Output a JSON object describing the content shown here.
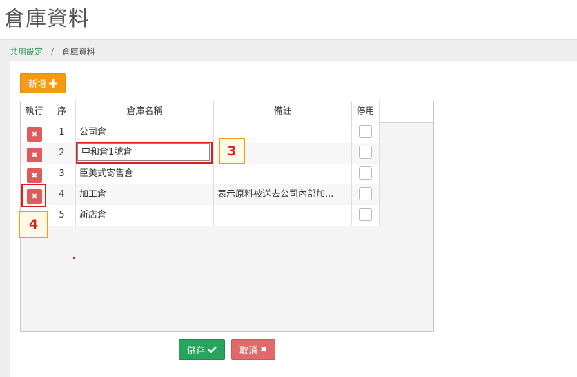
{
  "page": {
    "title": "倉庫資料"
  },
  "breadcrumb": {
    "parent": "共用設定",
    "separator": "/",
    "current": "倉庫資料"
  },
  "toolbar": {
    "add_label": "新增",
    "add_icon": "plus-icon"
  },
  "table": {
    "headers": {
      "exec": "執行",
      "seq": "序",
      "name": "倉庫名稱",
      "note": "備註",
      "disabled": "停用"
    },
    "rows": [
      {
        "seq": "1",
        "name": "公司倉",
        "note": "",
        "disabled": false
      },
      {
        "seq": "2",
        "name": "中和倉1號倉",
        "note": "",
        "disabled": false,
        "editing": true
      },
      {
        "seq": "3",
        "name": "臣美式寄售倉",
        "note": "",
        "disabled": false
      },
      {
        "seq": "4",
        "name": "加工倉",
        "note": "表示原料被送去公司內部加...",
        "disabled": false
      },
      {
        "seq": "5",
        "name": "新店倉",
        "note": "",
        "disabled": false
      }
    ],
    "delete_icon": "close-icon"
  },
  "annotations": {
    "callout_3": "3",
    "callout_4": "4",
    "highlight_color": "#d62020",
    "callout_border_color": "#f39c12"
  },
  "footer": {
    "save_label": "儲存",
    "save_icon": "check-icon",
    "cancel_label": "取消",
    "cancel_icon": "close-icon"
  },
  "colors": {
    "add": "#f39c12",
    "save": "#27a55f",
    "cancel": "#e06a6a",
    "delete": "#e05c5c",
    "breadcrumb_link": "#2e9b4f"
  }
}
